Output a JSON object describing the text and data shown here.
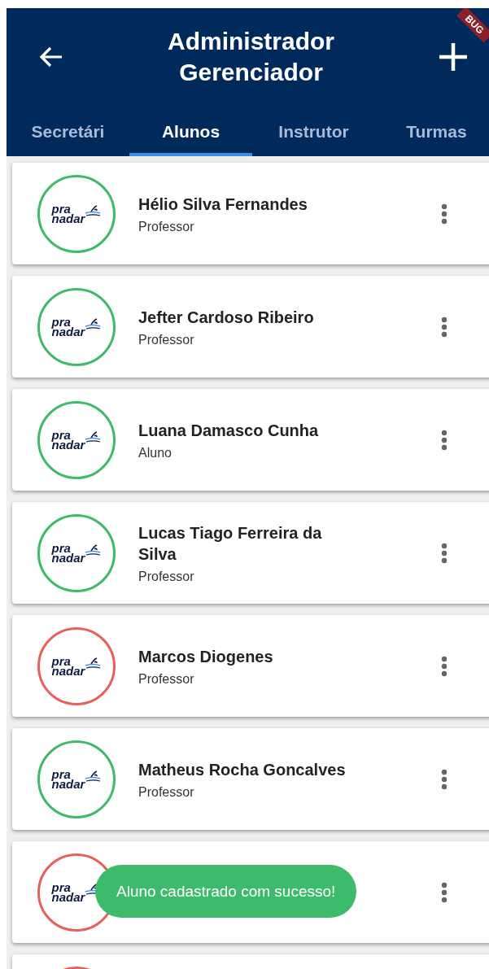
{
  "app_bar": {
    "title": "Administrador Gerenciador",
    "debug_banner": "BUG"
  },
  "tabs": [
    {
      "label": "Secretári",
      "selected": false
    },
    {
      "label": "Alunos",
      "selected": true
    },
    {
      "label": "Instrutor",
      "selected": false
    },
    {
      "label": "Turmas",
      "selected": false
    }
  ],
  "cards": [
    {
      "name": "Hélio Silva Fernandes",
      "role": "Professor",
      "color": "#3dba6a",
      "logo": [
        "pra",
        "nadar"
      ]
    },
    {
      "name": "Jefter Cardoso Ribeiro",
      "role": "Professor",
      "color": "#3dba6a",
      "logo": [
        "pra",
        "nadar"
      ]
    },
    {
      "name": "Luana Damasco Cunha",
      "role": "Aluno",
      "color": "#3dba6a",
      "logo": [
        "pra",
        "nadar"
      ]
    },
    {
      "name": "Lucas Tiago Ferreira da Silva",
      "role": "Professor",
      "color": "#3dba6a",
      "logo": [
        "pra",
        "nadar"
      ]
    },
    {
      "name": "Marcos Diogenes",
      "role": "Professor",
      "color": "#e8605a",
      "logo": [
        "pra",
        "nadar"
      ]
    },
    {
      "name": "Matheus Rocha Goncalves",
      "role": "Professor",
      "color": "#3dba6a",
      "logo": [
        "pra",
        "nadar"
      ]
    },
    {
      "color": "#e8605a",
      "logo": [
        "pra",
        "nadar"
      ]
    },
    {
      "color": "#e8605a"
    }
  ],
  "toast": {
    "message": "Aluno cadastrado com sucesso!"
  }
}
